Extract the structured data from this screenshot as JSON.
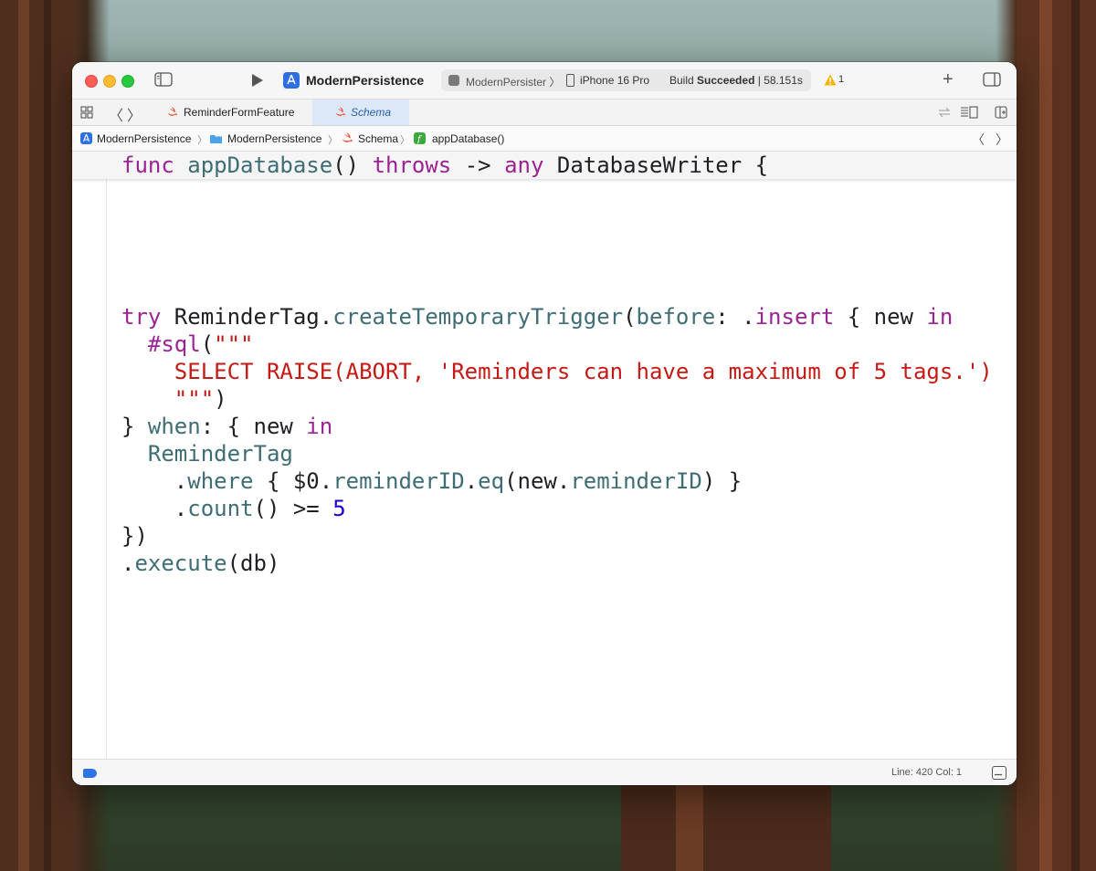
{
  "window": {
    "project_title": "ModernPersistence",
    "scheme": "ModernPersister",
    "destination": "iPhone 16 Pro",
    "build_status_prefix": "Build ",
    "build_status_bold": "Succeeded",
    "build_time": " | 58.151s",
    "warning_count": "1"
  },
  "tabs": [
    {
      "label": "ReminderFormFeature",
      "active": false
    },
    {
      "label": "Schema",
      "active": true
    }
  ],
  "breadcrumb": [
    {
      "label": "ModernPersistence",
      "icon": "app-icon"
    },
    {
      "label": "ModernPersistence",
      "icon": "folder-icon"
    },
    {
      "label": "Schema",
      "icon": "swift-icon"
    },
    {
      "label": "appDatabase()",
      "icon": "function-icon"
    }
  ],
  "sticky_header": {
    "t1": "func",
    "t2": "appDatabase",
    "t3": "() ",
    "t4": "throws",
    "t5": " -> ",
    "t6": "any",
    "t7": " DatabaseWriter {"
  },
  "code": {
    "l1": {
      "a": "try",
      "b": " ReminderTag.",
      "c": "createTemporaryTrigger",
      "d": "(",
      "e": "before",
      "f": ": .",
      "g": "insert",
      "h": " { new ",
      "i": "in"
    },
    "l2": {
      "a": "  ",
      "b": "#sql",
      "c": "(",
      "d": "\"\"\""
    },
    "l3": {
      "a": "    SELECT RAISE(ABORT, 'Reminders can have a maximum of 5 tags.')"
    },
    "l4": {
      "a": "    ",
      "b": "\"\"\"",
      "c": ")"
    },
    "l5": {
      "a": "} ",
      "b": "when",
      "c": ": { new ",
      "d": "in"
    },
    "l6": {
      "a": "  ReminderTag"
    },
    "l7": {
      "a": "    .",
      "b": "where",
      "c": " { $0.",
      "d": "reminderID",
      "e": ".",
      "f": "eq",
      "g": "(new.",
      "h": "reminderID",
      "i": ") }"
    },
    "l8": {
      "a": "    .",
      "b": "count",
      "c": "() >= ",
      "d": "5"
    },
    "l9": {
      "a": "})"
    },
    "l10": {
      "a": ".",
      "b": "execute",
      "c": "(db)"
    }
  },
  "status": {
    "line_col": "Line: 420  Col: 1"
  },
  "colors": {
    "keyword": "#9b2393",
    "type": "#3e6d74",
    "string": "#c41a16",
    "number": "#1c00cf",
    "accent": "#2f74e6"
  }
}
